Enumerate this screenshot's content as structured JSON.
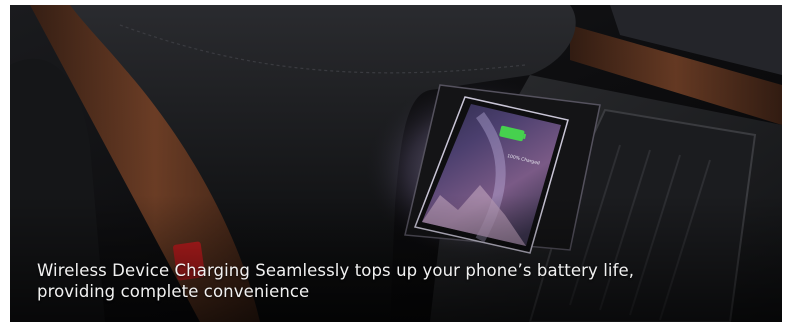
{
  "scene": {
    "subject": "car center console with wireless charging pad",
    "phone_screen_text": "100% Charged",
    "colors": {
      "background": "#0b0b0c",
      "leather": "#1d1e21",
      "wood_trim": "#6b3a22",
      "glow": "#e7dcff",
      "battery": "#46d14e"
    }
  },
  "caption": {
    "text": "Wireless Device Charging Seamlessly tops up your phone’s battery life, providing complete convenience"
  }
}
